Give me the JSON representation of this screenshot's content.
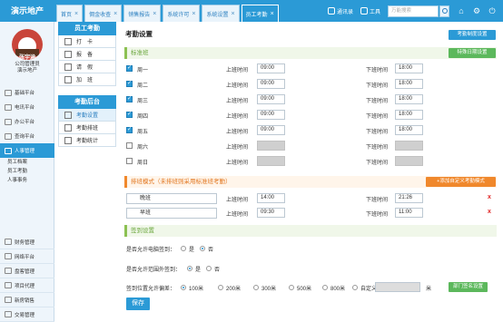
{
  "app": {
    "brand": "演示地产"
  },
  "tabs": [
    {
      "label": "首页",
      "active": false
    },
    {
      "label": "佣金收查",
      "active": false
    },
    {
      "label": "销售报告",
      "active": false
    },
    {
      "label": "系统许可",
      "active": false
    },
    {
      "label": "系统设置",
      "active": false
    },
    {
      "label": "员工考勤",
      "active": true
    }
  ],
  "topbar": {
    "contacts_label": "通讯录",
    "tools_label": "工具",
    "search_placeholder": "万能搜索"
  },
  "user": {
    "name": "张宇涵",
    "line1": "公司管理员",
    "line2": "演示地产"
  },
  "leftnav": {
    "items": [
      {
        "label": "基础平台",
        "icon": "monitor-icon"
      },
      {
        "label": "电讯平台",
        "icon": "phone-icon"
      },
      {
        "label": "办公平台",
        "icon": "folder-icon"
      },
      {
        "label": "查询平台",
        "icon": "chart-icon"
      },
      {
        "label": "人事管理",
        "icon": "people-icon",
        "active": true
      }
    ],
    "subitems": [
      "员工档案",
      "员工考勤",
      "人事事务"
    ],
    "items2": [
      {
        "label": "财务管理",
        "icon": "money-icon"
      },
      {
        "label": "网络平台",
        "icon": "globe-icon"
      },
      {
        "label": "盘客管理",
        "icon": "home-icon"
      },
      {
        "label": "项目代理",
        "icon": "building-icon"
      },
      {
        "label": "新房销售",
        "icon": "key-icon"
      },
      {
        "label": "交易管理",
        "icon": "handshake-icon"
      },
      {
        "label": "过户管理",
        "icon": "doc-icon"
      }
    ]
  },
  "col2": {
    "panel1_title": "员工考勤",
    "panel1_items": [
      "打　卡",
      "报　备",
      "请　假",
      "加　班"
    ],
    "panel2_title": "考勤后台",
    "panel2_items": [
      {
        "label": "考勤设置",
        "active": true
      },
      {
        "label": "考勤排班",
        "active": false
      },
      {
        "label": "考勤统计",
        "active": false
      }
    ]
  },
  "main": {
    "title": "考勤设置",
    "system_btn": "考勤制度设置",
    "standard_section": "标准班",
    "special_btn": "特殊日期设置",
    "on_label": "上班时间",
    "off_label": "下班时间",
    "days": [
      {
        "name": "周一",
        "checked": true,
        "on": "09:00",
        "off": "18:00"
      },
      {
        "name": "周二",
        "checked": true,
        "on": "09:00",
        "off": "18:00"
      },
      {
        "name": "周三",
        "checked": true,
        "on": "09:00",
        "off": "18:00"
      },
      {
        "name": "周四",
        "checked": true,
        "on": "09:00",
        "off": "18:00"
      },
      {
        "name": "周五",
        "checked": true,
        "on": "09:00",
        "off": "18:00"
      },
      {
        "name": "周六",
        "checked": false,
        "on": "",
        "off": ""
      },
      {
        "name": "周日",
        "checked": false,
        "on": "",
        "off": ""
      }
    ],
    "shift_section": "排班模式（未排班则采用标准班考勤）",
    "add_shift_btn": "+添加自定义考勤模式",
    "shifts": [
      {
        "name": "晚班",
        "on": "14:00",
        "off": "21:26",
        "delete": "x"
      },
      {
        "name": "早班",
        "on": "09:30",
        "off": "11:00",
        "delete": "x"
      }
    ],
    "sign_section": "签到设置",
    "q1": "是否允许电脑签到：",
    "q2": "是否允许范围外签到：",
    "q3": "签到位置允许偏差：",
    "yes": "是",
    "no": "否",
    "q1_value": "否",
    "q2_value": "是",
    "ranges": [
      "100米",
      "200米",
      "300米",
      "500米",
      "800米",
      "自定义"
    ],
    "range_selected": "100米",
    "meter_unit": "米",
    "dept_btn": "部门签名设置",
    "save_btn": "保存"
  }
}
